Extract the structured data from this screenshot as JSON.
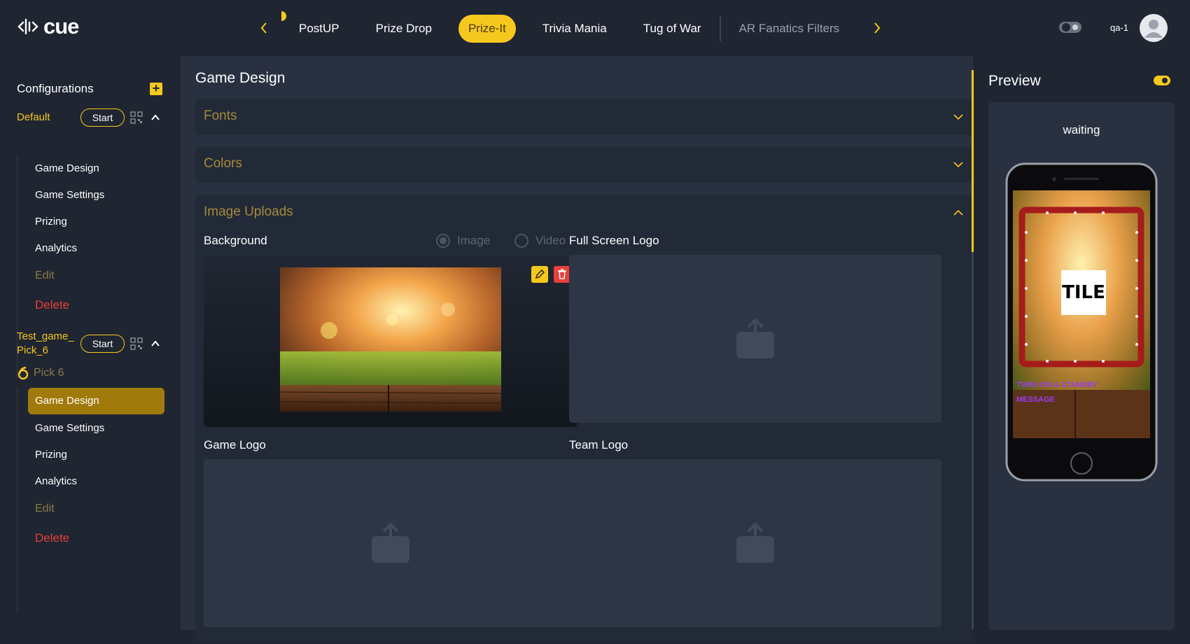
{
  "brand": {
    "name": "cue",
    "accent": "#f6c81d",
    "danger": "#e8403b"
  },
  "nav": {
    "tabs": [
      {
        "label": "PostUP",
        "state": "normal"
      },
      {
        "label": "Prize Drop",
        "state": "normal"
      },
      {
        "label": "Prize-It",
        "state": "active"
      },
      {
        "label": "Trivia Mania",
        "state": "normal"
      },
      {
        "label": "Tug of War",
        "state": "normal"
      },
      {
        "label": "AR Fanatics Filters",
        "state": "dim"
      }
    ],
    "prev_icon": "chevron-left-icon",
    "next_icon": "chevron-right-icon"
  },
  "user": {
    "name": "qa-1",
    "avatar_icon": "user-icon",
    "theme_toggle_icon": "theme-toggle-icon"
  },
  "sidebar": {
    "title": "Configurations",
    "add_icon": "plus-icon",
    "games": [
      {
        "name": "Default",
        "start_label": "Start",
        "menu": [
          "Game Design",
          "Game Settings",
          "Prizing",
          "Analytics"
        ],
        "edit_label": "Edit",
        "delete_label": "Delete"
      },
      {
        "name_line1": "Test_game_",
        "name_line2": "Pick_6",
        "start_label": "Start",
        "sub_label": "Pick 6",
        "menu": [
          "Game Design",
          "Game Settings",
          "Prizing",
          "Analytics"
        ],
        "active_item": "Game Design",
        "edit_label": "Edit",
        "delete_label": "Delete"
      }
    ]
  },
  "main": {
    "title": "Game Design",
    "sections": [
      {
        "label": "Fonts",
        "expanded": false
      },
      {
        "label": "Colors",
        "expanded": false
      },
      {
        "label": "Image Uploads",
        "expanded": true
      }
    ],
    "uploads": {
      "background_label": "Background",
      "radio_image": "Image",
      "radio_video": "Video",
      "selected_media": "Image",
      "full_screen_logo_label": "Full Screen Logo",
      "game_logo_label": "Game Logo",
      "team_logo_label": "Team Logo"
    }
  },
  "preview": {
    "title": "Preview",
    "status": "waiting",
    "tile_text": "TILE",
    "banner_text_1": "TURN ON & STANDBY",
    "banner_text_2": "MESSAGE"
  }
}
